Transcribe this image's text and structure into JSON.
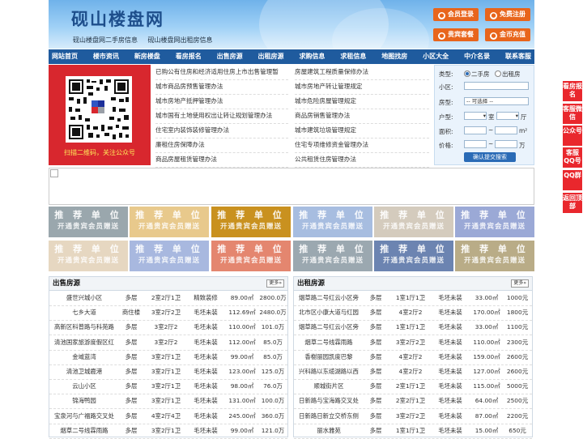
{
  "header": {
    "title": "砚山楼盘网",
    "subtitles": [
      "砚山楼盘网二手房信息",
      "砚山楼盘网出租房信息"
    ],
    "buttons": [
      {
        "label": "会员登录",
        "icon": "user-icon"
      },
      {
        "label": "免费注册",
        "icon": "register-icon"
      },
      {
        "label": "贵宾套餐",
        "icon": "vip-icon"
      },
      {
        "label": "金币充值",
        "icon": "coin-icon"
      }
    ]
  },
  "nav": [
    "网站首页",
    "楼市资讯",
    "新房楼盘",
    "看房报名",
    "出售房源",
    "出租房源",
    "求购信息",
    "求租信息",
    "地图找房",
    "小区大全",
    "中介名录",
    "联系客服"
  ],
  "qr": {
    "caption": "扫描二维码，关注公众号"
  },
  "links": {
    "left": [
      "已购公有住房和经济适用住房上市出售管理暂",
      "城市商品房预售管理办法",
      "城市房地产抵押管理办法",
      "城市国有土地使用权出让转让规划管理办法",
      "住宅室内装饰装修管理办法",
      "廉租住房保障办法",
      "商品房屋租赁管理办法"
    ],
    "right": [
      "房屋建筑工程质量保修办法",
      "城市房地产转让管理规定",
      "城市危险房屋管理规定",
      "商品房销售管理办法",
      "城市建筑垃圾管理规定",
      "住宅专项维修资金管理办法",
      "公共租赁住房管理办法"
    ]
  },
  "search": {
    "type": "类型:",
    "radio1": "二手房",
    "radio2": "出租房",
    "community": "小区:",
    "room_type": "房型:",
    "room_select": "-- 可选择 --",
    "layout": "户型:",
    "shi": "室",
    "ting": "厅",
    "area": "面积:",
    "price": "价格:",
    "tilde": "~",
    "area_unit": "m²",
    "price_unit": "万",
    "submit": "确认提交搜索"
  },
  "ads": {
    "line1": "推 荐 单 位",
    "line2": "开通贵宾会员赠送",
    "colors": [
      "#9aa7ad",
      "#e8c98c",
      "#c9911f",
      "#a7bde0",
      "#d4cbbd",
      "#9ba9d6",
      "#e6d7c1",
      "#a8b8df",
      "#e4866f",
      "#9ba8b0",
      "#6c84b1",
      "#b9ac87"
    ]
  },
  "sale": {
    "title": "出售房源",
    "more": "更多»",
    "rows": [
      [
        "盛世兴城小区",
        "多层",
        "2室2厅1卫",
        "精致装修",
        "89.00㎡",
        "2800.0万"
      ],
      [
        "七乡大道",
        "商住楼",
        "3室2厅2卫",
        "毛坯未装",
        "112.69㎡",
        "2480.0万"
      ],
      [
        "高新区科普路与科苑路",
        "多层",
        "3室2厅2",
        "毛坯未装",
        "110.00㎡",
        "101.0万"
      ],
      [
        "清池国家旅游度假区红",
        "多层",
        "3室2厅2",
        "毛坯未装",
        "112.00㎡",
        "85.0万"
      ],
      [
        "金域蓝湾",
        "多层",
        "3室2厅1卫",
        "毛坯未装",
        "99.00㎡",
        "85.0万"
      ],
      [
        "清池卫城鹿港",
        "多层",
        "3室2厅1卫",
        "毛坯未装",
        "123.00㎡",
        "125.0万"
      ],
      [
        "云山小区",
        "多层",
        "3室2厅1卫",
        "毛坯未装",
        "98.00㎡",
        "76.0万"
      ],
      [
        "锦海鸭园",
        "多层",
        "3室2厅1卫",
        "毛坯未装",
        "131.00㎡",
        "100.0万"
      ],
      [
        "宝泉河与广福路交叉处",
        "多层",
        "4室2厅4卫",
        "毛坯未装",
        "245.00㎡",
        "360.0万"
      ],
      [
        "烟草二号线霖雨路",
        "多层",
        "3室2厅1卫",
        "毛坯未装",
        "99.00㎡",
        "121.0万"
      ]
    ]
  },
  "rent": {
    "title": "出租房源",
    "more": "更多»",
    "rows": [
      [
        "烟草路二号红云小区旁",
        "多层",
        "1室1厅1卫",
        "毛坯未装",
        "33.00㎡",
        "1000元"
      ],
      [
        "北市区小康大道与红园",
        "多层",
        "4室2厅2",
        "毛坯未装",
        "170.00㎡",
        "1800元"
      ],
      [
        "烟草路二号红云小区旁",
        "多层",
        "1室1厅1卫",
        "毛坯未装",
        "33.00㎡",
        "1100元"
      ],
      [
        "烟草二号线霖雨路",
        "多层",
        "3室2厅2卫",
        "毛坯未装",
        "110.00㎡",
        "2300元"
      ],
      [
        "香榭丽园凯度巴黎",
        "多层",
        "4室2厅2",
        "毛坯未装",
        "159.00㎡",
        "2600元"
      ],
      [
        "兴科路以东缆湖路以西",
        "多层",
        "4室2厅2",
        "毛坯未装",
        "127.00㎡",
        "2600元"
      ],
      [
        "顺城街片区",
        "多层",
        "2室1厅1卫",
        "毛坯未装",
        "115.00㎡",
        "5000元"
      ],
      [
        "日新路与宝海路交叉处",
        "多层",
        "2室2厅1卫",
        "毛坯未装",
        "64.00㎡",
        "2500元"
      ],
      [
        "日新路日新立交桥东侧",
        "多层",
        "3室2厅2卫",
        "毛坯未装",
        "87.00㎡",
        "2200元"
      ],
      [
        "丽水雅苑",
        "多层",
        "1室1厅1卫",
        "毛坯未装",
        "15.00㎡",
        "650元"
      ]
    ]
  },
  "side": [
    "看房报名",
    "客服微信",
    "公众号",
    "客服QQ号",
    "QQ群",
    "返回顶部"
  ]
}
